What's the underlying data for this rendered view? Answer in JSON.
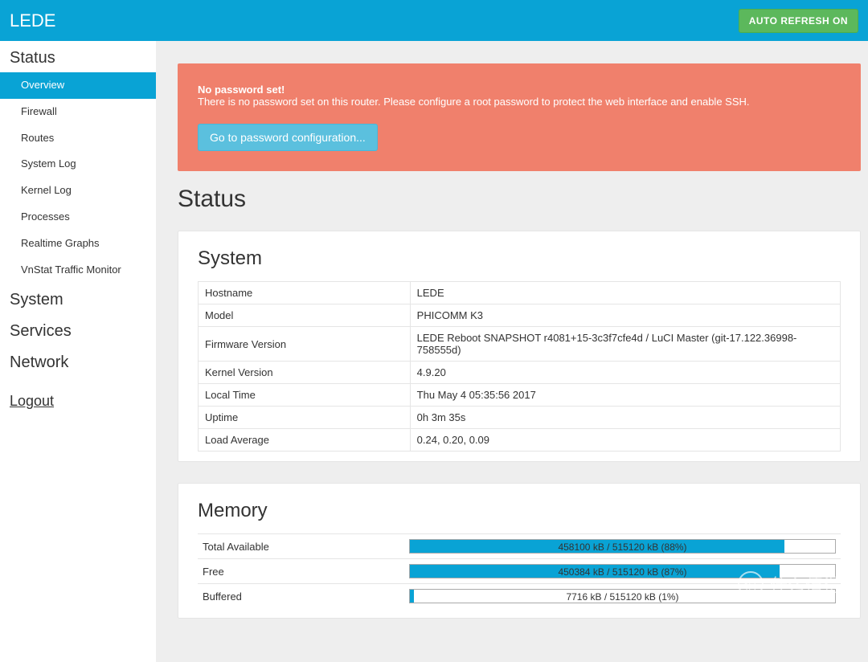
{
  "header": {
    "brand": "LEDE",
    "refresh_label": "AUTO REFRESH ON"
  },
  "sidebar": {
    "status_heading": "Status",
    "status_items": [
      "Overview",
      "Firewall",
      "Routes",
      "System Log",
      "Kernel Log",
      "Processes",
      "Realtime Graphs",
      "VnStat Traffic Monitor"
    ],
    "active_index": 0,
    "system_heading": "System",
    "services_heading": "Services",
    "network_heading": "Network",
    "logout_label": "Logout"
  },
  "alert": {
    "title": "No password set!",
    "body": "There is no password set on this router. Please configure a root password to protect the web interface and enable SSH.",
    "button": "Go to password configuration..."
  },
  "page_title": "Status",
  "system_panel": {
    "heading": "System",
    "rows": [
      {
        "k": "Hostname",
        "v": "LEDE"
      },
      {
        "k": "Model",
        "v": "PHICOMM K3"
      },
      {
        "k": "Firmware Version",
        "v": "LEDE Reboot SNAPSHOT r4081+15-3c3f7cfe4d / LuCI Master (git-17.122.36998-758555d)"
      },
      {
        "k": "Kernel Version",
        "v": "4.9.20"
      },
      {
        "k": "Local Time",
        "v": "Thu May 4 05:35:56 2017"
      },
      {
        "k": "Uptime",
        "v": "0h 3m 35s"
      },
      {
        "k": "Load Average",
        "v": "0.24, 0.20, 0.09"
      }
    ]
  },
  "memory_panel": {
    "heading": "Memory",
    "rows": [
      {
        "label": "Total Available",
        "text": "458100 kB / 515120 kB (88%)",
        "pct": 88
      },
      {
        "label": "Free",
        "text": "450384 kB / 515120 kB (87%)",
        "pct": 87
      },
      {
        "label": "Buffered",
        "text": "7716 kB / 515120 kB (1%)",
        "pct": 1
      }
    ]
  },
  "watermark": "什么值得买"
}
